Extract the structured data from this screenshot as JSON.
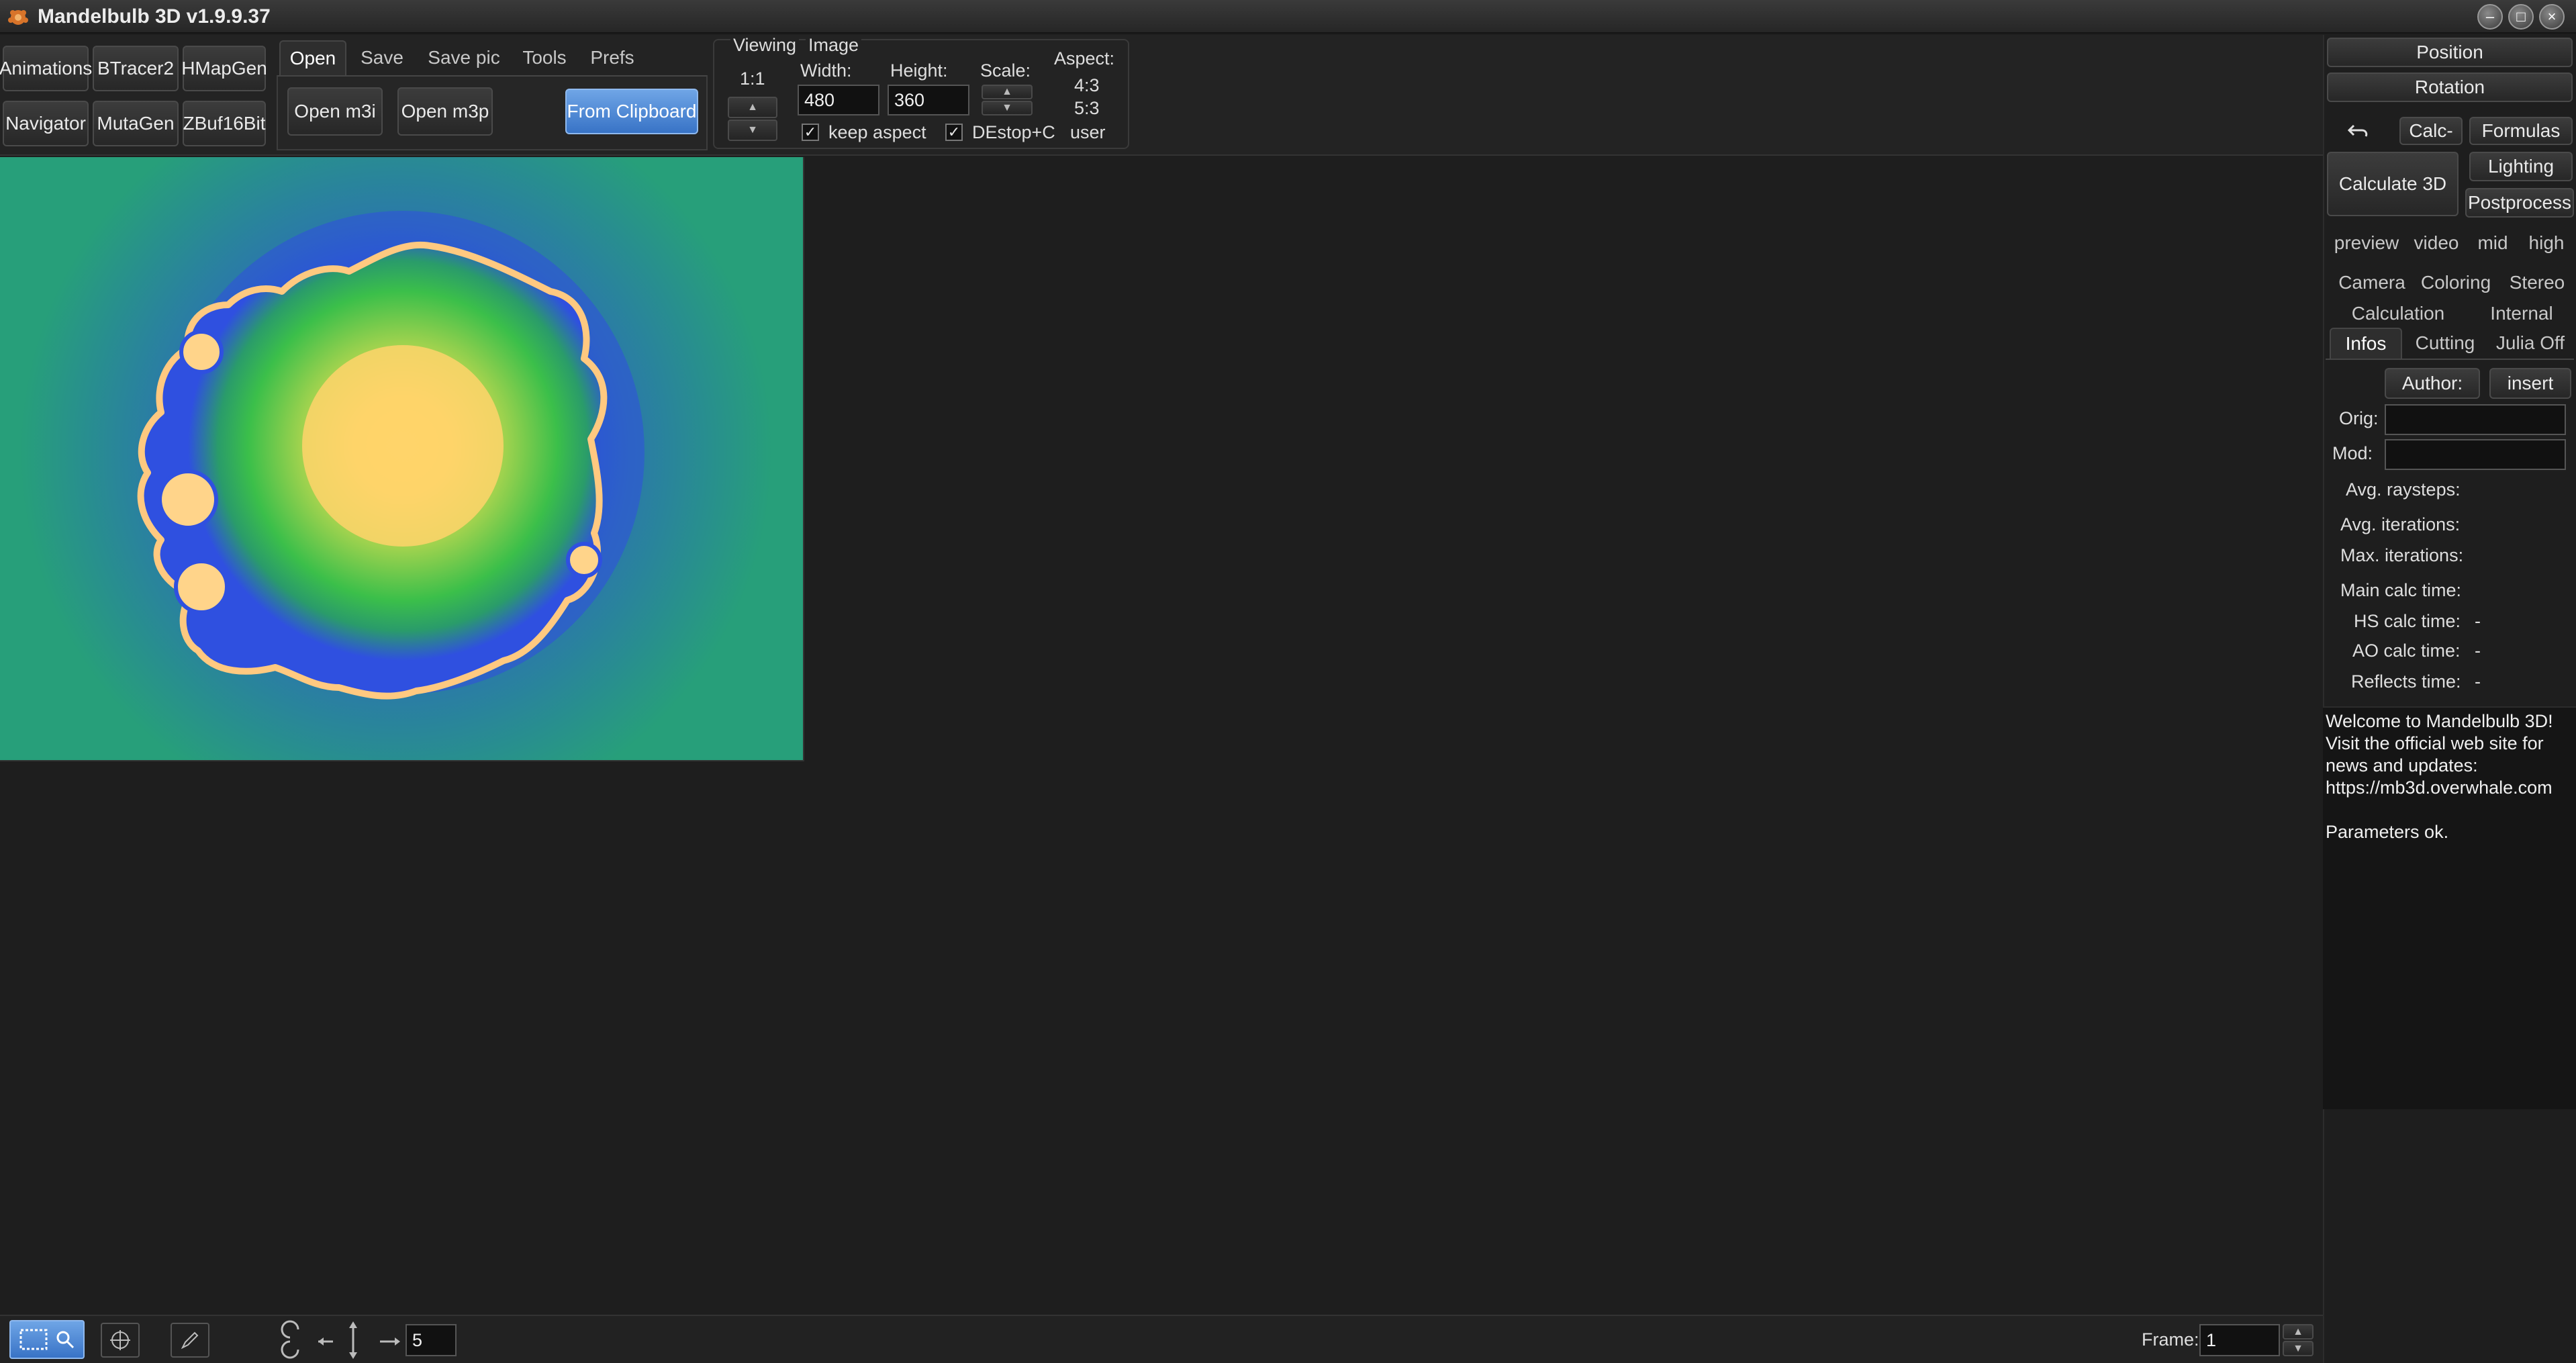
{
  "window": {
    "title": "Mandelbulb 3D   v1.9.9.37",
    "controls": {
      "minimize": "–",
      "maximize": "□",
      "close": "×"
    }
  },
  "toolbar": {
    "tool_buttons": [
      "Animations",
      "BTracer2",
      "HMapGen",
      "Navigator",
      "MutaGen",
      "ZBuf16Bit"
    ],
    "tabs": [
      "Open",
      "Save",
      "Save pic",
      "Tools",
      "Prefs"
    ],
    "active_tab": "Open",
    "open_m3i": "Open m3i",
    "open_m3p": "Open m3p",
    "from_clipboard": "From Clipboard"
  },
  "image_settings": {
    "viewing_label": "Viewing",
    "image_label": "Image",
    "ratio_label": "1:1",
    "width_label": "Width:",
    "height_label": "Height:",
    "scale_label": "Scale:",
    "aspect_label": "Aspect:",
    "aspect_options": [
      "4:3",
      "5:3",
      "user"
    ],
    "width_value": "480",
    "height_value": "360",
    "keep_aspect_label": "keep aspect",
    "keep_aspect_checked": true,
    "destop_label": "DEstop+C",
    "destop_checked": true
  },
  "right_panel": {
    "position": "Position",
    "rotation": "Rotation",
    "undo_icon": "undo-arrow",
    "calc_label": "Calc-",
    "formulas": "Formulas",
    "calculate_3d": "Calculate 3D",
    "lighting": "Lighting",
    "postprocess": "Postprocess",
    "quality_options": [
      "preview",
      "video",
      "mid",
      "high"
    ],
    "tabs_row1": [
      "Camera",
      "Coloring",
      "Stereo"
    ],
    "tabs_row2": [
      "Calculation",
      "Internal"
    ],
    "tabs_row3": [
      "Infos",
      "Cutting",
      "Julia Off"
    ],
    "active_tab": "Infos",
    "author_button": "Author:",
    "insert_button": "insert",
    "orig_label": "Orig:",
    "orig_value": "",
    "mod_label": "Mod:",
    "mod_value": "",
    "stats": [
      {
        "label": "Avg. raysteps:",
        "value": ""
      },
      {
        "label": "Avg. iterations:",
        "value": ""
      },
      {
        "label": "Max. iterations:",
        "value": ""
      },
      {
        "label": "Main calc time:",
        "value": ""
      },
      {
        "label": "HS calc time:",
        "value": "-"
      },
      {
        "label": "AO calc time:",
        "value": "-"
      },
      {
        "label": "Reflects time:",
        "value": "-"
      }
    ],
    "log": "Welcome to Mandelbulb 3D!\nVisit the official web site for news and updates:\nhttps://mb3d.overwhale.com\n\nParameters ok."
  },
  "statusbar": {
    "step_value": "5",
    "frame_label": "Frame:",
    "frame_value": "1"
  },
  "colors": {
    "background": "#1e1e1e",
    "accent_blue": "#3873c6",
    "fractal_core": "#ffd36a",
    "fractal_mid": "#3bbf4a",
    "fractal_edge": "#2f50e0"
  }
}
